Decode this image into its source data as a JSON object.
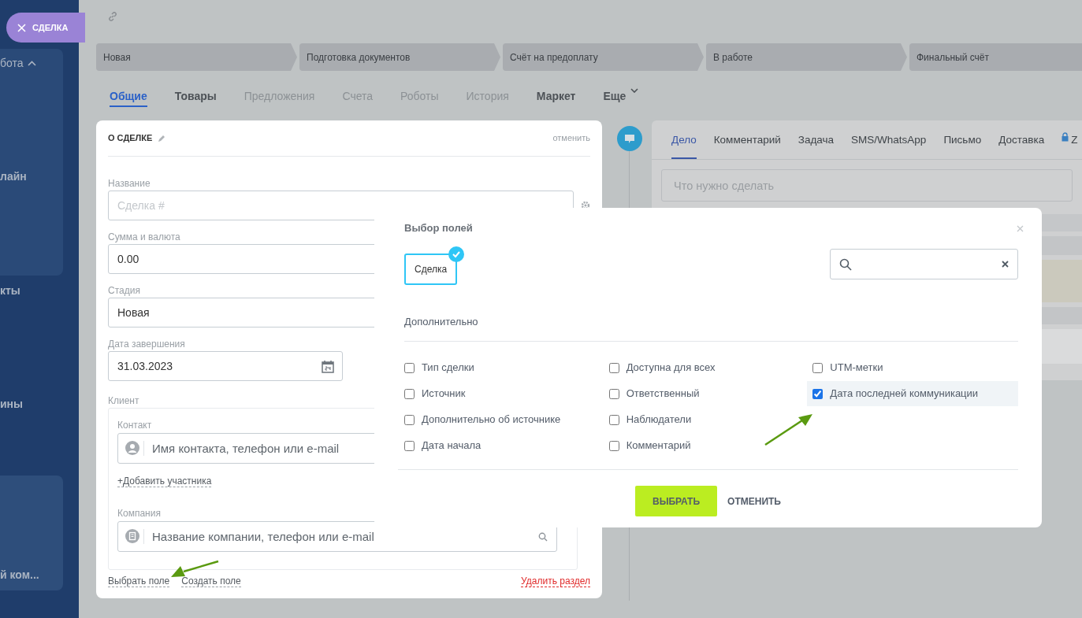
{
  "close_button": {
    "label": "СДЕЛКА"
  },
  "sidebar": {
    "items": [
      {
        "label": "бота",
        "expanded": true
      },
      {
        "label": "лайн"
      },
      {
        "label": "кты"
      },
      {
        "label": "ины"
      },
      {
        "label": "й ком..."
      }
    ]
  },
  "stages": [
    {
      "label": "Новая"
    },
    {
      "label": "Подготовка документов"
    },
    {
      "label": "Счёт на предоплату"
    },
    {
      "label": "В работе"
    },
    {
      "label": "Финальный счёт"
    }
  ],
  "tabs": [
    {
      "label": "Общие",
      "selected": true,
      "disabled": false
    },
    {
      "label": "Товары",
      "selected": false,
      "disabled": false
    },
    {
      "label": "Предложения",
      "selected": false,
      "disabled": true
    },
    {
      "label": "Счета",
      "selected": false,
      "disabled": true
    },
    {
      "label": "Роботы",
      "selected": false,
      "disabled": true
    },
    {
      "label": "История",
      "selected": false,
      "disabled": true
    },
    {
      "label": "Маркет",
      "selected": false,
      "disabled": false
    },
    {
      "label": "Еще",
      "selected": false,
      "disabled": false,
      "has_menu": true
    }
  ],
  "deal_card": {
    "title": "О СДЕЛКЕ",
    "cancel": "отменить",
    "fields": [
      {
        "kind": "text",
        "label": "Название",
        "placeholder": "Сделка #",
        "settings": true
      },
      {
        "kind": "text",
        "label": "Сумма и валюта",
        "value": "0.00"
      },
      {
        "kind": "text",
        "label": "Стадия",
        "value": "Новая"
      },
      {
        "kind": "date",
        "label": "Дата завершения",
        "value": "31.03.2023"
      }
    ],
    "client": {
      "label": "Клиент",
      "contact_label": "Контакт",
      "contact_placeholder": "Имя контакта, телефон или e-mail",
      "add_participant": "+Добавить участника",
      "company_label": "Компания",
      "company_placeholder": "Название компании, телефон или e-mail"
    },
    "links": [
      "Выбрать поле",
      "Создать поле"
    ],
    "delete": "Удалить раздел"
  },
  "activity": {
    "tabs": [
      {
        "label": "Дело",
        "selected": true,
        "locked": false
      },
      {
        "label": "Комментарий",
        "selected": false,
        "locked": false
      },
      {
        "label": "Задача",
        "selected": false,
        "locked": false
      },
      {
        "label": "SMS/WhatsApp",
        "selected": false,
        "locked": false
      },
      {
        "label": "Письмо",
        "selected": false,
        "locked": false
      },
      {
        "label": "Доставка",
        "selected": false,
        "locked": false
      },
      {
        "label": "Z",
        "selected": false,
        "locked": true
      }
    ],
    "placeholder": "Что нужно сделать"
  },
  "dialog": {
    "title": "Выбор полей",
    "entities": [
      {
        "label": "Сделка",
        "selected": true
      }
    ],
    "section": "Дополнительно",
    "columns": [
      [
        {
          "label": "Тип сделки",
          "checked": false
        },
        {
          "label": "Источник",
          "checked": false
        },
        {
          "label": "Дополнительно об источнике",
          "checked": false
        },
        {
          "label": "Дата начала",
          "checked": false
        }
      ],
      [
        {
          "label": "Доступна для всех",
          "checked": false
        },
        {
          "label": "Ответственный",
          "checked": false
        },
        {
          "label": "Наблюдатели",
          "checked": false
        },
        {
          "label": "Комментарий",
          "checked": false
        }
      ],
      [
        {
          "label": "UTM-метки",
          "checked": false
        },
        {
          "label": "Дата последней коммуникации",
          "checked": true
        }
      ]
    ],
    "buttons": [
      {
        "label": "ВЫБРАТЬ",
        "kind": "primary"
      },
      {
        "label": "ОТМЕНИТЬ",
        "kind": "link"
      }
    ]
  }
}
